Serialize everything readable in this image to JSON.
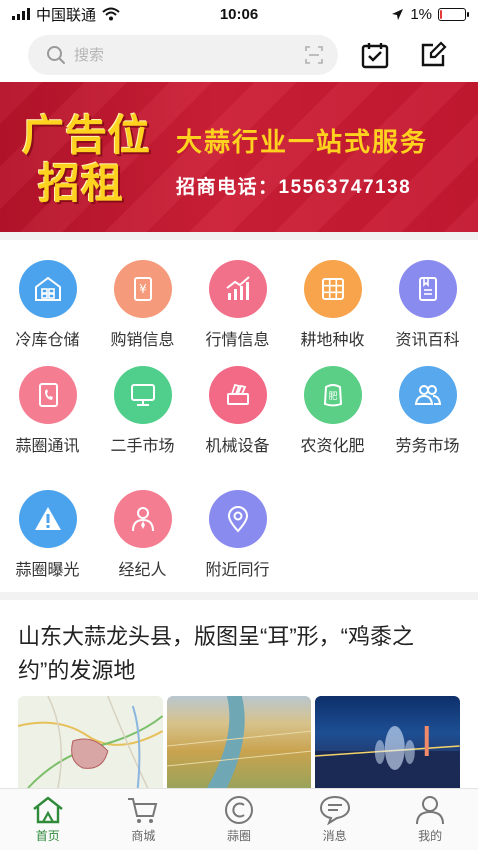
{
  "status_bar": {
    "carrier": "中国联通",
    "time": "10:06",
    "battery": "1%",
    "battery_level": 0.01
  },
  "search": {
    "placeholder": "搜索"
  },
  "top_icons": [
    "calendar-check-icon",
    "edit-icon"
  ],
  "banner": {
    "logo_line1": "广告位",
    "logo_line2": "招租",
    "headline": "大蒜行业一站式服务",
    "phone": "招商电话：15563747138"
  },
  "categories": [
    {
      "label": "冷库仓储",
      "icon": "warehouse-icon",
      "color": "#4aa3ec"
    },
    {
      "label": "购销信息",
      "icon": "yuan-receipt-icon",
      "color": "#f59a7a"
    },
    {
      "label": "行情信息",
      "icon": "market-chart-icon",
      "color": "#f1718a"
    },
    {
      "label": "耕地种收",
      "icon": "field-grid-icon",
      "color": "#f7a44c"
    },
    {
      "label": "资讯百科",
      "icon": "book-icon",
      "color": "#8a8bef"
    },
    {
      "label": "蒜圈通讯",
      "icon": "phone-book-icon",
      "color": "#f47d92"
    },
    {
      "label": "二手市场",
      "icon": "monitor-icon",
      "color": "#4fcf8b"
    },
    {
      "label": "机械设备",
      "icon": "machine-icon",
      "color": "#f26a86"
    },
    {
      "label": "农资化肥",
      "icon": "fertilizer-bag-icon",
      "color": "#5bcf86"
    },
    {
      "label": "劳务市场",
      "icon": "workers-icon",
      "color": "#57a8ec"
    },
    {
      "label": "蒜圈曝光",
      "icon": "warning-icon",
      "color": "#4aa3ec"
    },
    {
      "label": "经纪人",
      "icon": "broker-icon",
      "color": "#f47d92"
    },
    {
      "label": "附近同行",
      "icon": "location-pin-icon",
      "color": "#8a8bef"
    }
  ],
  "article": {
    "title": "山东大蒜龙头县，版图呈“耳”形，“鸡黍之约”的发源地"
  },
  "tabbar": [
    {
      "label": "首页",
      "icon": "home-icon",
      "active": true
    },
    {
      "label": "商城",
      "icon": "cart-icon",
      "active": false
    },
    {
      "label": "蒜圈",
      "icon": "circle-c-icon",
      "active": false
    },
    {
      "label": "消息",
      "icon": "message-icon",
      "active": false
    },
    {
      "label": "我的",
      "icon": "profile-icon",
      "active": false
    }
  ],
  "colors": {
    "accent": "#2f8b3a",
    "banner_red": "#c41830",
    "banner_gold": "#ffd21f"
  }
}
